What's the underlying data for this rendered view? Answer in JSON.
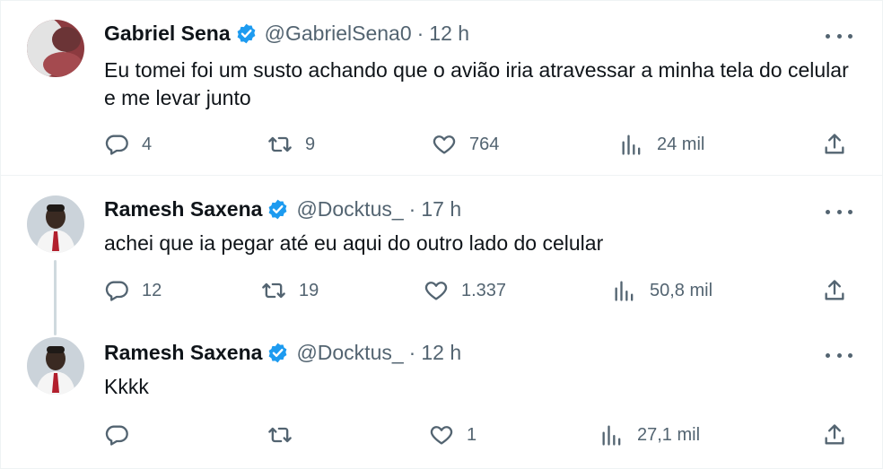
{
  "colors": {
    "verified": "#1d9bf0",
    "text": "#0f1419",
    "muted": "#536471",
    "divider": "#eff3f4"
  },
  "icons": {
    "reply": "speech-bubble-icon",
    "repost": "repost-arrows-icon",
    "like": "heart-icon",
    "views": "bar-chart-icon",
    "share": "share-upload-icon",
    "more": "three-dots-icon",
    "verified": "verified-badge-icon"
  },
  "tweets": [
    {
      "name": "Gabriel Sena",
      "handle": "@GabrielSena0",
      "dot": "·",
      "time": "12 h",
      "text": "Eu tomei foi um susto achando que o avião iria atravessar a minha tela do celular e me levar junto",
      "replies": "4",
      "reposts": "9",
      "likes": "764",
      "views": "24 mil"
    },
    {
      "name": "Ramesh Saxena",
      "handle": "@Docktus_",
      "dot": "·",
      "time": "17 h",
      "text": "achei que ia pegar até eu aqui do outro lado do celular",
      "replies": "12",
      "reposts": "19",
      "likes": "1.337",
      "views": "50,8 mil"
    },
    {
      "name": "Ramesh Saxena",
      "handle": "@Docktus_",
      "dot": "·",
      "time": "12 h",
      "text": "Kkkk",
      "replies": "",
      "reposts": "",
      "likes": "1",
      "views": "27,1 mil"
    }
  ]
}
